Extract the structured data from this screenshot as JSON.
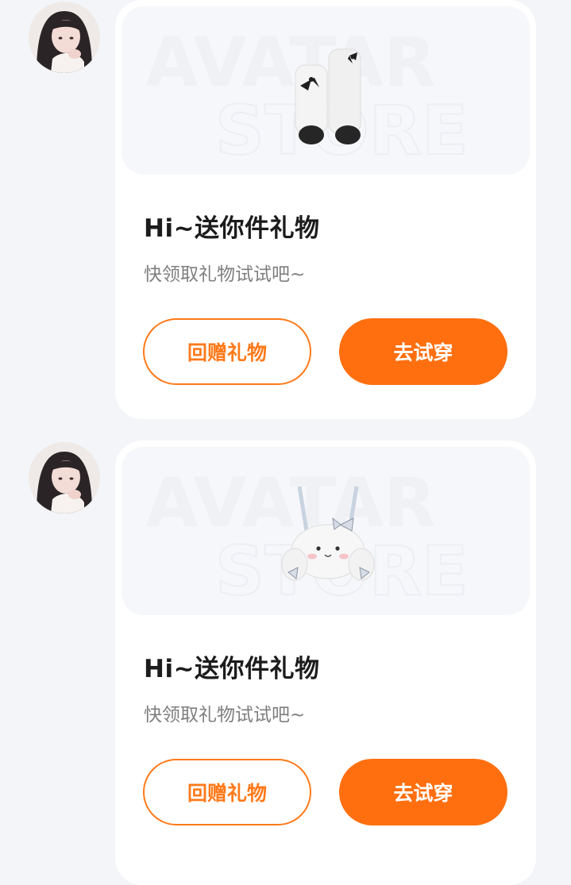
{
  "colors": {
    "accent": "#ff6f0f",
    "background": "#f3f5f8",
    "card": "#ffffff"
  },
  "messages": [
    {
      "title": "Hi~送你件礼物",
      "subtitle": "快领取礼物试试吧~",
      "watermark_line1": "AVATAR",
      "watermark_line2": "STORE",
      "product_icon": "socks-icon",
      "return_label": "回赠礼物",
      "try_label": "去试穿"
    },
    {
      "title": "Hi~送你件礼物",
      "subtitle": "快领取礼物试试吧~",
      "watermark_line1": "AVATAR",
      "watermark_line2": "STORE",
      "product_icon": "bunny-bag-icon",
      "return_label": "回赠礼物",
      "try_label": "去试穿"
    }
  ]
}
